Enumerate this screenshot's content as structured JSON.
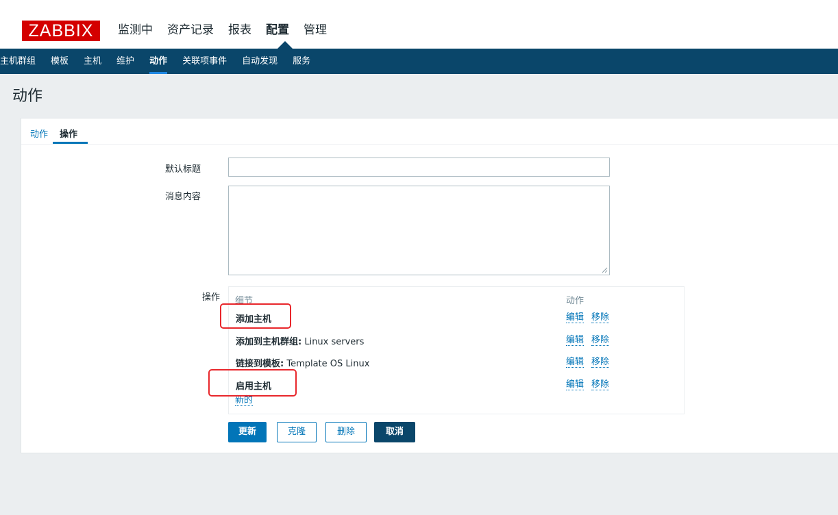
{
  "logo": "ZABBIX",
  "main_menu": [
    "监测中",
    "资产记录",
    "报表",
    "配置",
    "管理"
  ],
  "main_menu_selected": "配置",
  "sub_menu": [
    "主机群组",
    "模板",
    "主机",
    "维护",
    "动作",
    "关联项事件",
    "自动发现",
    "服务"
  ],
  "sub_menu_selected": "动作",
  "page_title": "动作",
  "tabs": [
    "动作",
    "操作"
  ],
  "tab_selected": "操作",
  "form": {
    "default_subject_label": "默认标题",
    "default_subject_value": "",
    "message_label": "消息内容",
    "message_value": "",
    "operations_label": "操作"
  },
  "operations": {
    "header_details": "细节",
    "header_action": "动作",
    "rows": [
      {
        "bold": "添加主机",
        "rest": "",
        "edit": "编辑",
        "remove": "移除"
      },
      {
        "bold": "添加到主机群组:",
        "rest": " Linux servers",
        "edit": "编辑",
        "remove": "移除"
      },
      {
        "bold": "链接到模板:",
        "rest": " Template OS Linux",
        "edit": "编辑",
        "remove": "移除"
      },
      {
        "bold": "启用主机",
        "rest": "",
        "edit": "编辑",
        "remove": "移除"
      }
    ],
    "new_link": "新的"
  },
  "buttons": {
    "update": "更新",
    "clone": "克隆",
    "delete": "删除",
    "cancel": "取消"
  },
  "colors": {
    "brand_red": "#d40000",
    "nav_dark": "#0a466a",
    "link_blue": "#0275b8",
    "highlight_red": "#e8262b"
  }
}
